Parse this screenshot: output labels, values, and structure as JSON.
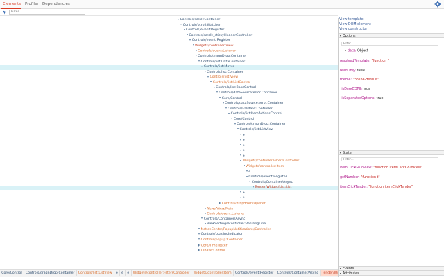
{
  "tabs": [
    "Elements",
    "Profiler",
    "Dependencies"
  ],
  "search_placeholder": "Filter...",
  "icons": {
    "settings": "gear-icon",
    "pick": "node-picker-icon"
  },
  "colors": {
    "accent": "#d83c24",
    "selected_row": "#d9f2f7",
    "link": "#3a5d99"
  },
  "tree": [
    {
      "indent": 0,
      "label": "Controls/scroll:Container",
      "color": "dark"
    },
    {
      "indent": 1,
      "label": "Controls/scroll:Watcher",
      "color": "dark"
    },
    {
      "indent": 2,
      "label": "Controls/event:Register",
      "color": "dark"
    },
    {
      "indent": 3,
      "label": "Controls/scroll:_stickyHeaderController",
      "color": "dark"
    },
    {
      "indent": 4,
      "label": "Controls/event:Register",
      "color": "dark"
    },
    {
      "indent": 5,
      "label": "Widgets/controller:View",
      "color": "red"
    },
    {
      "indent": 6,
      "label": "Controls/event:Listener",
      "color": "orange",
      "leaf": true
    },
    {
      "indent": 6,
      "label": "Controls/dragnDrop:Container",
      "color": "dark"
    },
    {
      "indent": 7,
      "label": "Controls/list:DataContainer",
      "color": "dark"
    },
    {
      "indent": 8,
      "label": "Controls/list:Mover",
      "color": "dark",
      "highlight": true
    },
    {
      "indent": 9,
      "label": "Controls/list:Container",
      "color": "dark"
    },
    {
      "indent": 10,
      "label": "Controls/list:View",
      "color": "orange"
    },
    {
      "indent": 11,
      "label": "Controls/list:ListControl",
      "color": "orange"
    },
    {
      "indent": 12,
      "label": "Controls/list:BaseControl",
      "color": "dark"
    },
    {
      "indent": 13,
      "label": "Controls/dataSource:error.Container",
      "color": "dark"
    },
    {
      "indent": 14,
      "label": "Core/Control",
      "color": "dark"
    },
    {
      "indent": 15,
      "label": "Controls/dataSource:error.Container",
      "color": "dark"
    },
    {
      "indent": 16,
      "label": "Controls/validate:Controller",
      "color": "dark"
    },
    {
      "indent": 17,
      "label": "Controls/list:ItemActionsControl",
      "color": "dark"
    },
    {
      "indent": 18,
      "label": "Core/Control",
      "color": "dark"
    },
    {
      "indent": 19,
      "label": "Controls/dragnDrop:Container",
      "color": "dark"
    },
    {
      "indent": 20,
      "label": "Controls/list:ListView",
      "color": "dark"
    },
    {
      "indent": 21,
      "label": "e",
      "color": "dark"
    },
    {
      "indent": 21,
      "label": "e",
      "color": "dark"
    },
    {
      "indent": 21,
      "label": "e",
      "color": "dark"
    },
    {
      "indent": 21,
      "label": "e",
      "color": "dark"
    },
    {
      "indent": 21,
      "label": "e",
      "color": "dark"
    },
    {
      "indent": 21,
      "label": "Widgets/controller:FiltersController",
      "color": "orange"
    },
    {
      "indent": 22,
      "label": "Widgets/controller:Item",
      "color": "orange"
    },
    {
      "indent": 23,
      "label": "e",
      "color": "dark"
    },
    {
      "indent": 23,
      "label": "Controls/event:Register",
      "color": "dark"
    },
    {
      "indent": 24,
      "label": "Controls/Container/Async",
      "color": "dark"
    },
    {
      "indent": 25,
      "label": "Tender/Widget/List:List",
      "color": "red",
      "highlight": true
    },
    {
      "indent": 21,
      "label": "e",
      "color": "dark"
    },
    {
      "indent": 21,
      "label": "e",
      "color": "dark"
    },
    {
      "indent": 14,
      "label": "Controls/dropdown:Opener",
      "color": "orange",
      "leaf": true
    },
    {
      "indent": 9,
      "label": "News/View/Main",
      "color": "orange",
      "leaf": true
    },
    {
      "indent": 9,
      "label": "Controls/event:Listener",
      "color": "orange",
      "leaf": true
    },
    {
      "indent": 8,
      "label": "Controls/Container/Async",
      "color": "dark"
    },
    {
      "indent": 9,
      "label": "ViewSettings/controller:ResizingLine",
      "color": "dark"
    },
    {
      "indent": 7,
      "label": "NoticeCenter/PopupNotifications/Controller",
      "color": "orange"
    },
    {
      "indent": 7,
      "label": "Controls/LoadingIndicator",
      "color": "dark"
    },
    {
      "indent": 7,
      "label": "Controls/popup:Container",
      "color": "orange"
    },
    {
      "indent": 7,
      "label": "Core/TimeTester",
      "color": "orange",
      "leaf": true
    },
    {
      "indent": 7,
      "label": "UIBase:Control",
      "color": "orange",
      "leaf": true
    }
  ],
  "breadcrumb": [
    {
      "label": "Core/Control",
      "style": "dark"
    },
    {
      "label": "Controls/dragnDrop:Container",
      "style": "dark"
    },
    {
      "label": "Controls/list:ListView",
      "style": "orange"
    },
    {
      "label": "e",
      "style": "dark"
    },
    {
      "label": "e",
      "style": "dark"
    },
    {
      "label": "e",
      "style": "dark"
    },
    {
      "label": "Widgets/controller:FiltersController",
      "style": "orange"
    },
    {
      "label": "Widgets/controller:Item",
      "style": "orange"
    },
    {
      "label": "Controls/event:Register",
      "style": "dark"
    },
    {
      "label": "Controls/Container/Async",
      "style": "dark"
    },
    {
      "label": "Tender/Widget/List:List",
      "style": "selected"
    }
  ],
  "right_links": [
    "View template",
    "View DOM element",
    "View constructor"
  ],
  "options": {
    "title": "Options",
    "filter_placeholder": "Filter...",
    "data_label": "data:",
    "data_value": "Object",
    "props": [
      {
        "key": "resolvedTemplate:",
        "value": "\"function \""
      },
      {
        "key": "readOnly:",
        "value": "false"
      },
      {
        "key": "theme:",
        "value": "\"online-default\""
      },
      {
        "key": "_isDomCORE:",
        "value": "true"
      },
      {
        "key": "_isSeparatedOptions:",
        "value": "true"
      }
    ]
  },
  "state": {
    "title": "State",
    "filter_placeholder": "Filter...",
    "props": [
      {
        "key": "itemClickGoToView:",
        "value": "\"function itemClickGoToView\""
      },
      {
        "key": "getNumber:",
        "value": "\"function t\""
      },
      {
        "key": "itemClickTender:",
        "value": "\"function itemClickTender\""
      }
    ]
  },
  "events_title": "Events",
  "attributes_title": "Attributes"
}
